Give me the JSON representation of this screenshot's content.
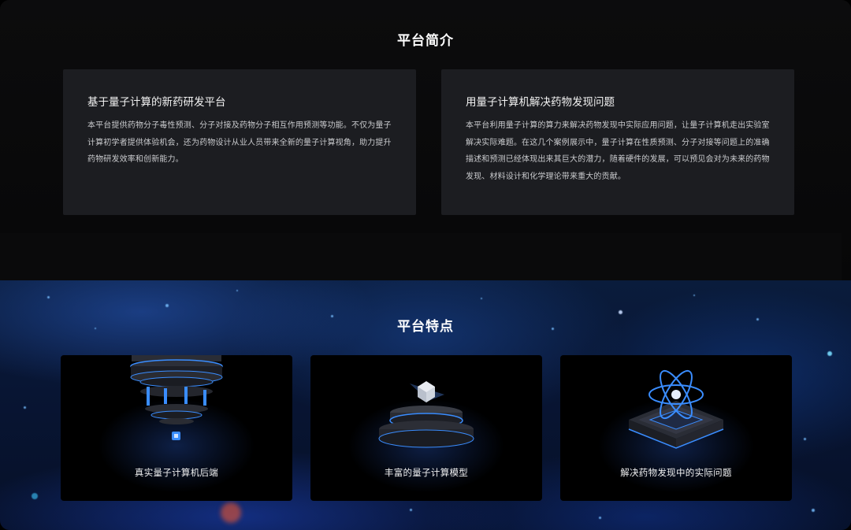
{
  "intro": {
    "title": "平台简介",
    "cards": [
      {
        "heading": "基于量子计算的新药研发平台",
        "body": "本平台提供药物分子毒性预测、分子对接及药物分子相互作用预测等功能。不仅为量子计算初学者提供体验机会，还为药物设计从业人员带来全新的量子计算视角，助力提升药物研发效率和创新能力。"
      },
      {
        "heading": "用量子计算机解决药物发现问题",
        "body": "本平台利用量子计算的算力来解决药物发现中实际应用问题，让量子计算机走出实验室解决实际难题。在这几个案例展示中，量子计算在性质预测、分子对接等问题上的准确描述和预测已经体现出来其巨大的潜力，随着硬件的发展，可以预见会对为未来的药物发现、材料设计和化学理论带来重大的贡献。"
      }
    ]
  },
  "features": {
    "title": "平台特点",
    "cards": [
      {
        "label": "真实量子计算机后端",
        "icon": "quantum-computer-icon"
      },
      {
        "label": "丰富的量子计算模型",
        "icon": "cube-platform-icon"
      },
      {
        "label": "解决药物发现中的实际问题",
        "icon": "atom-chip-icon"
      }
    ]
  },
  "colors": {
    "card_bg": "#1c1d21",
    "accent_blue": "#3a8dff",
    "section_bg_top": "#0c0c0d"
  }
}
